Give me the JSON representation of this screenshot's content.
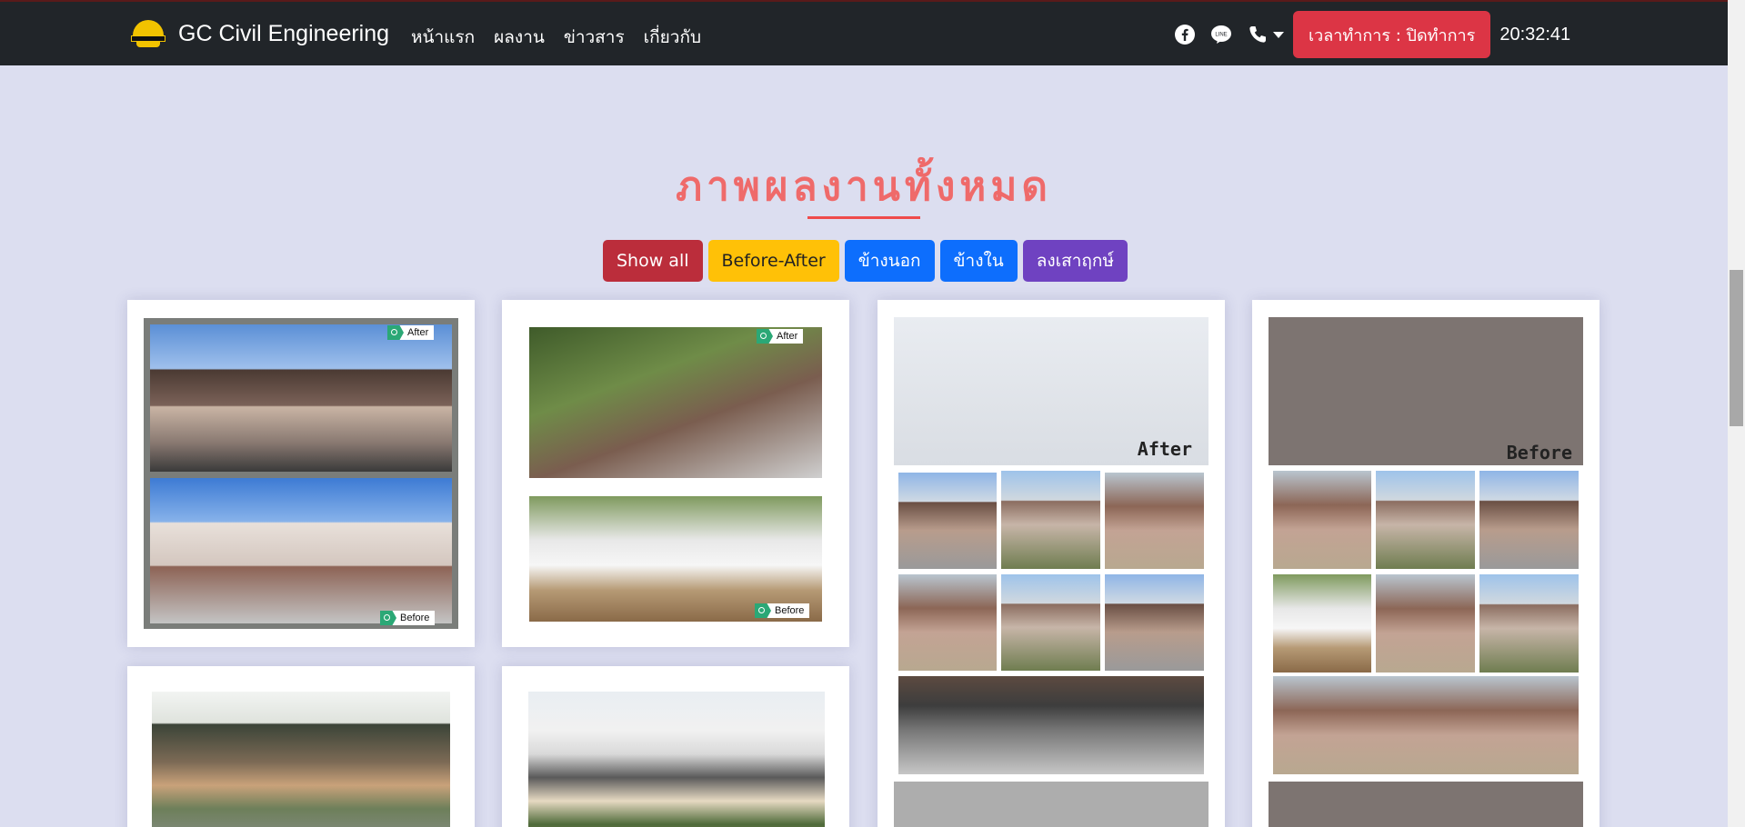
{
  "navbar": {
    "brand": "GC Civil Engineering",
    "links": [
      "หน้าแรก",
      "ผลงาน",
      "ข่าวสาร",
      "เกี่ยวกับ"
    ],
    "icons": [
      "facebook-icon",
      "line-chat-icon",
      "phone-icon",
      "chevron-down-icon"
    ],
    "hours_button": "เวลาทำการ : ปิดทำการ",
    "clock": "20:32:41"
  },
  "section": {
    "title": "ภาพผลงานทั้งหมด"
  },
  "filters": [
    {
      "label": "Show all",
      "color": "#bb2d3b"
    },
    {
      "label": "Before-After",
      "color": "#ffc107"
    },
    {
      "label": "ข้างนอก",
      "color": "#0d6efd"
    },
    {
      "label": "ข้างใน",
      "color": "#0d6efd"
    },
    {
      "label": "ลงเสาฤกษ์",
      "color": "#6f42c1"
    }
  ],
  "gallery": {
    "card1": {
      "after_tag": "After",
      "before_tag": "Before"
    },
    "card2": {
      "after_tag": "After",
      "before_tag": "Before"
    },
    "card3": {
      "label": "After"
    },
    "card4": {
      "label": "Before"
    }
  },
  "colors": {
    "accent_red": "#dc3545",
    "title_color": "#ef6a6a",
    "page_bg": "#dcdef0",
    "navbar_bg": "#212529"
  }
}
